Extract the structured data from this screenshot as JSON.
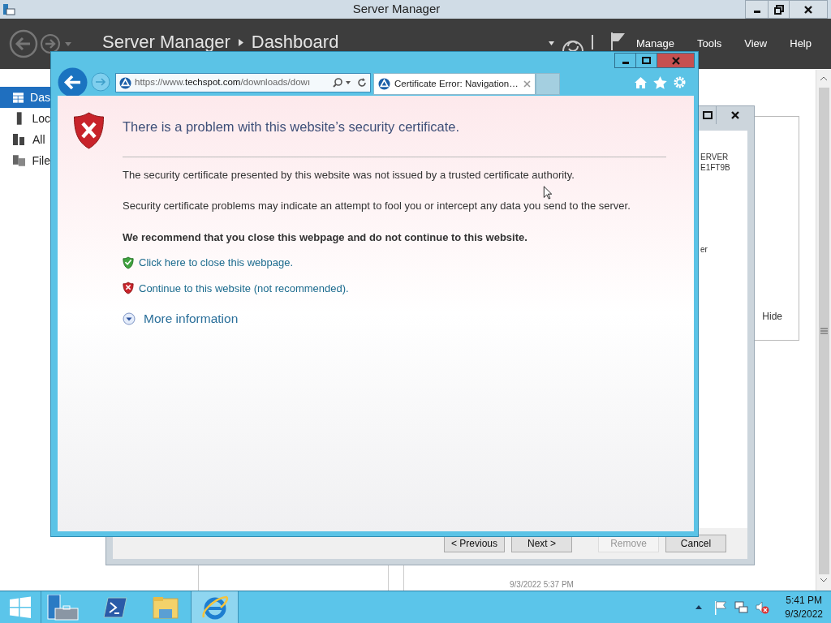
{
  "server_manager": {
    "title": "Server Manager",
    "breadcrumb": [
      "Server Manager",
      "Dashboard"
    ],
    "menu": [
      "Manage",
      "Tools",
      "View",
      "Help"
    ],
    "sidebar": [
      {
        "label": "Das",
        "selected": true
      },
      {
        "label": "Loc",
        "selected": false
      },
      {
        "label": "All",
        "selected": false
      },
      {
        "label": "File",
        "selected": false
      }
    ],
    "hide": "Hide",
    "timestamp": "9/3/2022 5:37 PM"
  },
  "wizard": {
    "texts": [
      "ERVER",
      "E1FT9B",
      "er"
    ],
    "buttons": [
      {
        "label": "< Previous",
        "disabled": false
      },
      {
        "label": "Next >",
        "disabled": false
      },
      {
        "label": "Remove",
        "disabled": true
      },
      {
        "label": "Cancel",
        "disabled": false
      }
    ]
  },
  "browser": {
    "url": {
      "prefix": "https://www.",
      "domain": "techspot.com",
      "path": "/downloads/dowı"
    },
    "tabs": [
      {
        "title": "Certificate Error: Navigation…",
        "selected": true
      }
    ],
    "heading": "There is a problem with this website’s security certificate.",
    "paragraphs": [
      "The security certificate presented by this website was not issued by a trusted certificate authority.",
      "Security certificate problems may indicate an attempt to fool you or intercept any data you send to the server."
    ],
    "recommendation": "We recommend that you close this webpage and do not continue to this website.",
    "links": [
      {
        "kind": "safe",
        "label": "Click here to close this webpage."
      },
      {
        "kind": "unsafe",
        "label": "Continue to this website (not recommended)."
      }
    ],
    "more_info": "More information"
  },
  "taskbar": {
    "apps": [
      {
        "kind": "server-manager",
        "selected": false
      },
      {
        "kind": "powershell",
        "selected": false
      },
      {
        "kind": "explorer",
        "selected": false
      },
      {
        "kind": "browser",
        "selected": true
      }
    ],
    "clock": {
      "time": "5:41 PM",
      "date": "9/3/2022"
    }
  }
}
